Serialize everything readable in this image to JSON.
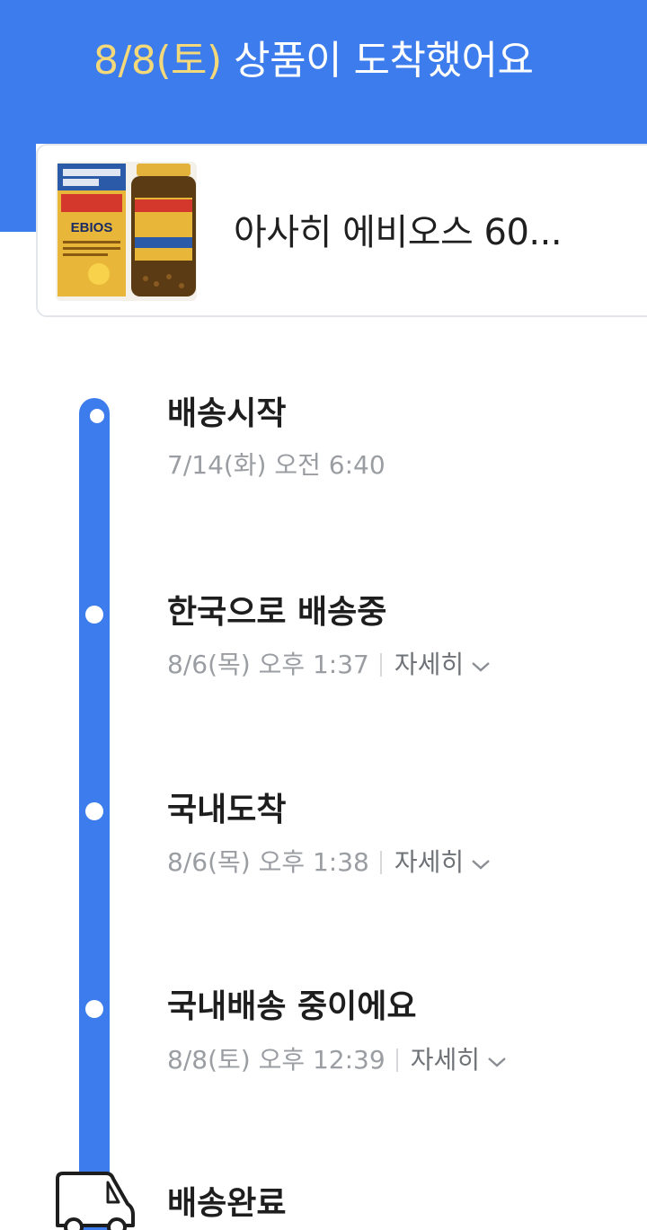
{
  "header": {
    "date": "8/8(토)",
    "message": "상품이 도착했어요"
  },
  "colors": {
    "accent": "#3d7cec",
    "header_date": "#f4d97a",
    "meta_text": "#9a9da2"
  },
  "product": {
    "name": "아사히 에비오스 60...",
    "image_icon": "product-photo",
    "box_label": "EBIOS"
  },
  "timeline": [
    {
      "title": "배송시작",
      "time": "7/14(화) 오전 6:40"
    },
    {
      "title": "한국으로 배송중",
      "time": "8/6(목) 오후 1:37",
      "detail": "자세히"
    },
    {
      "title": "국내도착",
      "time": "8/6(목) 오후 1:38",
      "detail": "자세히"
    },
    {
      "title": "국내배송 중이에요",
      "time": "8/8(토) 오후 12:39",
      "detail": "자세히"
    },
    {
      "title": "배송완료",
      "icon": "truck-icon"
    }
  ]
}
